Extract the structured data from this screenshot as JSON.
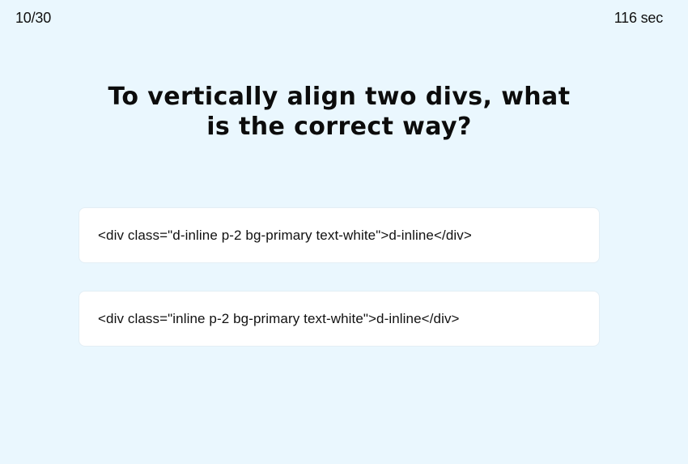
{
  "header": {
    "progress": "10/30",
    "timer": "116 sec"
  },
  "question": {
    "text": "To vertically align two divs, what is the correct way?"
  },
  "answers": [
    {
      "label": "<div class=\"d-inline p-2 bg-primary text-white\">d-inline</div>"
    },
    {
      "label": "<div class=\"inline p-2 bg-primary text-white\">d-inline</div>"
    }
  ],
  "colors": {
    "background": "#eaf7fe",
    "card": "#ffffff",
    "text": "#111111"
  }
}
